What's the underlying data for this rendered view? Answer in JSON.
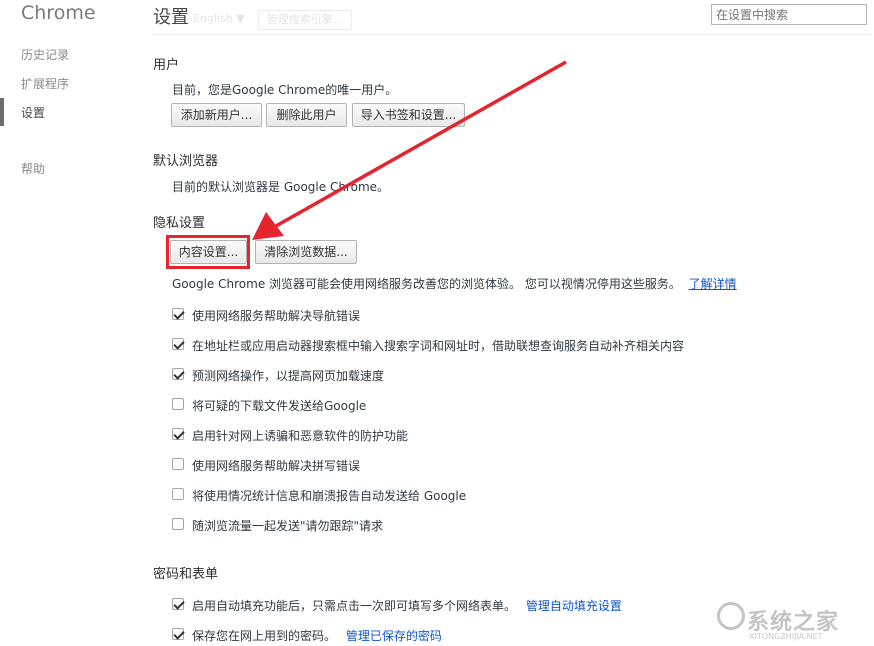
{
  "sidebar": {
    "brand": "Chrome",
    "items": [
      {
        "label": "历史记录"
      },
      {
        "label": "扩展程序"
      },
      {
        "label": "设置"
      },
      {
        "label": "帮助"
      }
    ]
  },
  "header": {
    "title": "设置",
    "search_placeholder": "在设置中搜索",
    "ghost_lang": "English ▼",
    "ghost_button": "管理搜索引擎..."
  },
  "users": {
    "title": "用户",
    "desc": "目前，您是Google Chrome的唯一用户。",
    "buttons": [
      "添加新用户...",
      "删除此用户",
      "导入书签和设置..."
    ]
  },
  "default_browser": {
    "title": "默认浏览器",
    "desc": "目前的默认浏览器是 Google Chrome。"
  },
  "privacy": {
    "title": "隐私设置",
    "content_button": "内容设置...",
    "clear_button": "清除浏览数据...",
    "desc": "Google Chrome 浏览器可能会使用网络服务改善您的浏览体验。 您可以视情况停用这些服务。",
    "learn_more": "了解详情",
    "options": [
      {
        "label": "使用网络服务帮助解决导航错误",
        "checked": true
      },
      {
        "label": "在地址栏或应用启动器搜索框中输入搜索字词和网址时，借助联想查询服务自动补齐相关内容",
        "checked": true
      },
      {
        "label": "预测网络操作，以提高网页加载速度",
        "checked": true
      },
      {
        "label": "将可疑的下载文件发送给Google",
        "checked": false
      },
      {
        "label": "启用针对网上诱骗和恶意软件的防护功能",
        "checked": true
      },
      {
        "label": "使用网络服务帮助解决拼写错误",
        "checked": false
      },
      {
        "label": "将使用情况统计信息和崩溃报告自动发送给 Google",
        "checked": false
      },
      {
        "label": "随浏览流量一起发送\"请勿跟踪\"请求",
        "checked": false
      }
    ]
  },
  "passwords": {
    "title": "密码和表单",
    "autofill_label": "启用自动填充功能后，只需点击一次即可填写多个网络表单。",
    "autofill_link": "管理自动填充设置",
    "save_label": "保存您在网上用到的密码。",
    "save_link": "管理已保存的密码"
  },
  "annotation": {
    "arrow_color": "#e4252f"
  },
  "watermark": {
    "text": "系统之家",
    "url": "XITONGZHIJIA.NET"
  }
}
